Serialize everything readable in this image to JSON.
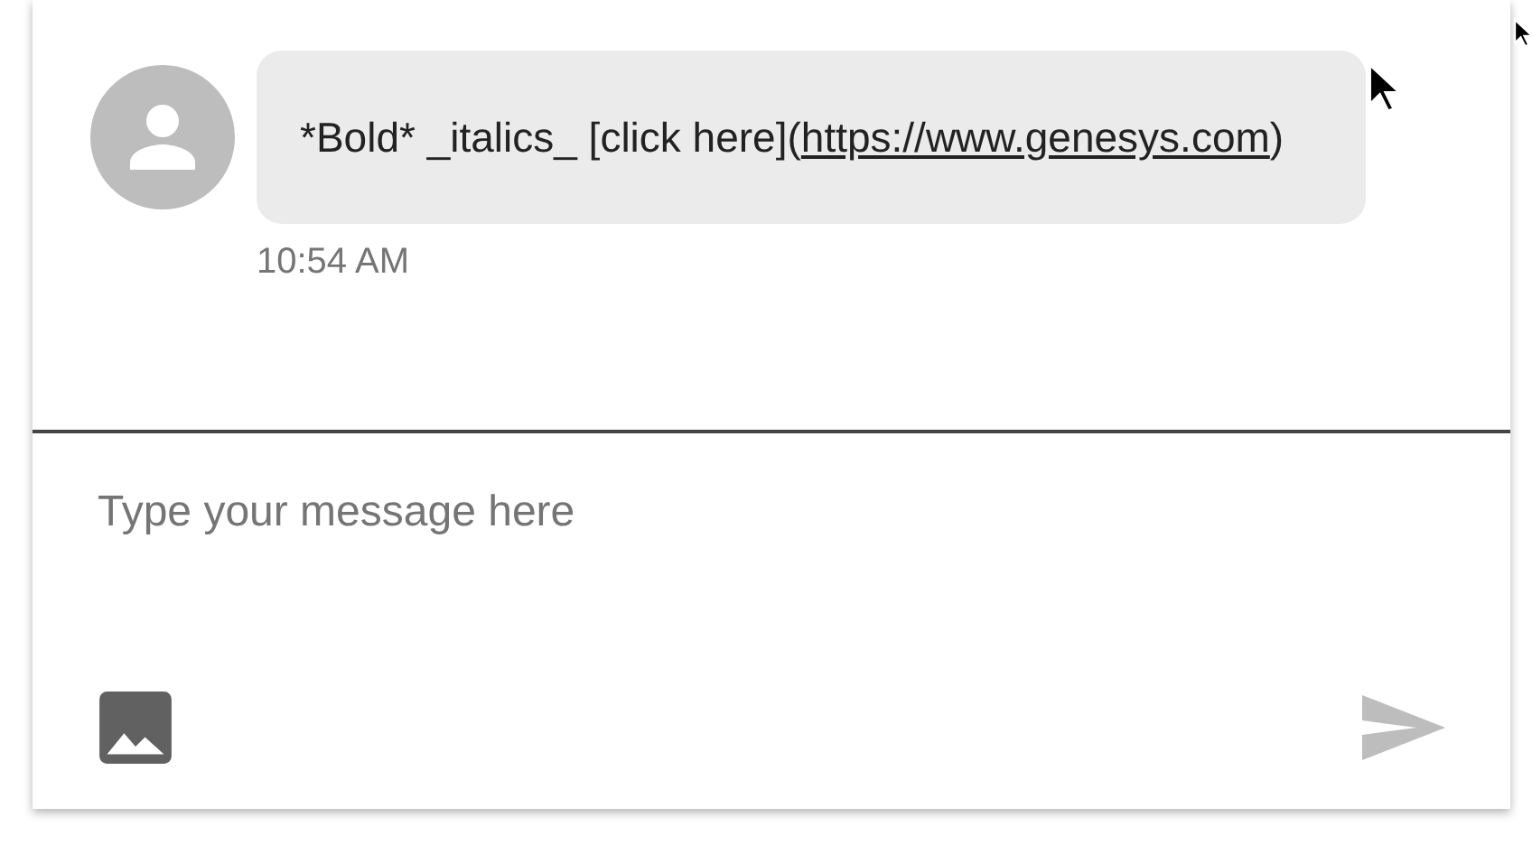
{
  "messages": [
    {
      "text_before": "*Bold* _italics_ [click here](",
      "link": "https://www.genesys.com",
      "text_after": ")",
      "time": "10:54 AM"
    }
  ],
  "composer": {
    "placeholder": "Type your message here",
    "send_disabled": true
  }
}
